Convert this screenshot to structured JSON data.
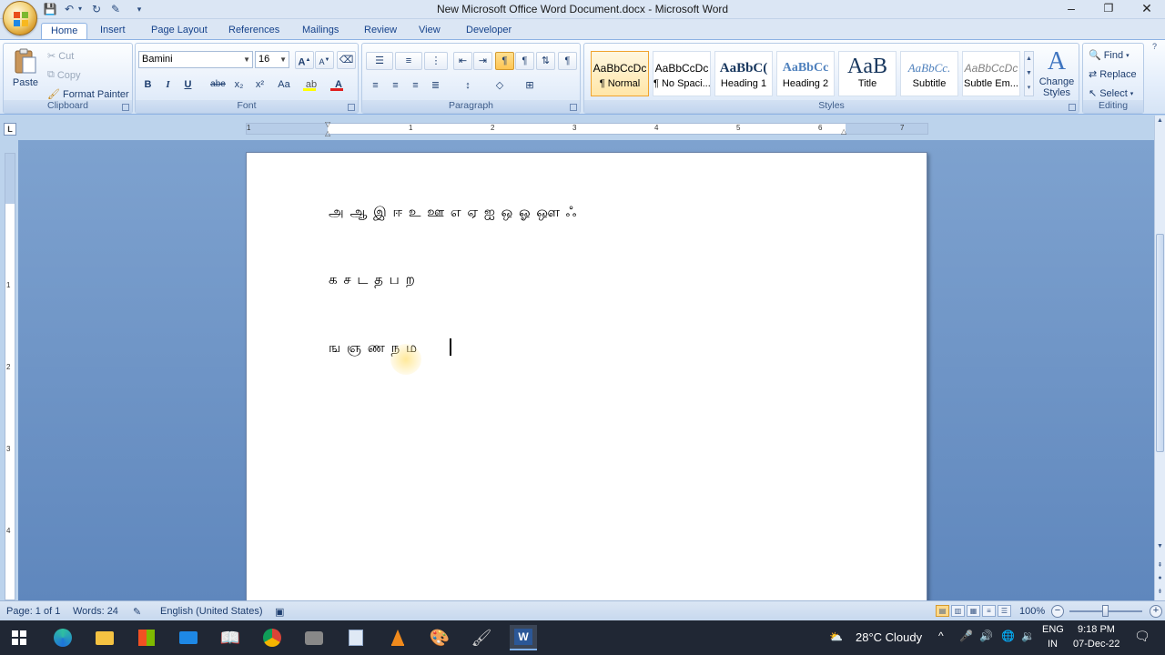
{
  "window": {
    "title": "New Microsoft Office Word Document.docx - Microsoft Word",
    "controls": [
      "–",
      "❐",
      "✕"
    ]
  },
  "tabs": [
    "Home",
    "Insert",
    "Page Layout",
    "References",
    "Mailings",
    "Review",
    "View",
    "Developer"
  ],
  "active_tab": "Home",
  "clipboard": {
    "paste": "Paste",
    "cut": "Cut",
    "copy": "Copy",
    "format_painter": "Format Painter",
    "label": "Clipboard"
  },
  "font": {
    "name": "Bamini",
    "size": "16",
    "label": "Font",
    "bold": "B",
    "italic": "I",
    "underline": "U",
    "strike": "abe",
    "sub": "x₂",
    "sup": "x²",
    "case": "Aa",
    "grow": "A",
    "shrink": "A",
    "highlight_color": "#ffff00",
    "font_color": "#e01f1f"
  },
  "paragraph": {
    "label": "Paragraph"
  },
  "styles": {
    "label": "Styles",
    "items": [
      {
        "sample": "AaBbCcDc",
        "name": "¶ Normal"
      },
      {
        "sample": "AaBbCcDc",
        "name": "¶ No Spaci..."
      },
      {
        "sample": "AaBbC(",
        "name": "Heading 1"
      },
      {
        "sample": "AaBbCc",
        "name": "Heading 2"
      },
      {
        "sample": "AaB",
        "name": "Title"
      },
      {
        "sample": "AaBbCc.",
        "name": "Subtitle"
      },
      {
        "sample": "AaBbCcDc",
        "name": "Subtle Em..."
      }
    ],
    "change_styles": "Change Styles"
  },
  "editing": {
    "label": "Editing",
    "find": "Find",
    "replace": "Replace",
    "select": "Select"
  },
  "ruler": {
    "h_numbers": [
      "1",
      "1",
      "2",
      "3",
      "4",
      "5",
      "6",
      "7"
    ],
    "v_numbers": [
      "1",
      "2",
      "3",
      "4"
    ]
  },
  "document": {
    "lines": [
      "அ ஆ இ ஈ உ ஊ எ ஏ ஐ ஒ ஓ ஔ ஃ",
      "க ச ட த ப ற",
      "ங ஞ ண ந ம"
    ]
  },
  "status": {
    "page": "Page: 1 of 1",
    "words": "Words: 24",
    "language": "English (United States)",
    "zoom": "100%"
  },
  "taskbar": {
    "weather": "28°C  Cloudy",
    "lang_top": "ENG",
    "lang_bottom": "IN",
    "time": "9:18 PM",
    "date": "07-Dec-22"
  }
}
